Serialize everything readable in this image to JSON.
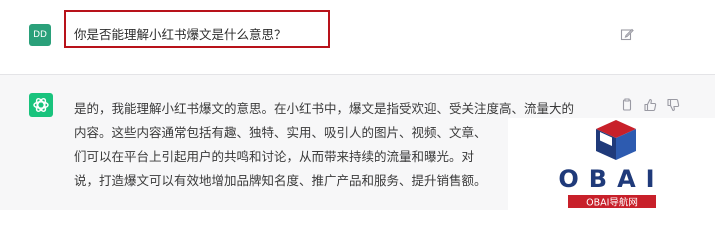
{
  "user": {
    "avatar_initials": "DD",
    "message": "你是否能理解小红书爆文是什么意思？"
  },
  "assistant": {
    "lines": [
      "是的，我能理解小红书爆文的意思。在小红书中，爆文是指受欢迎、受关注度高、流量大的",
      "内容。这些内容通常包括有趣、独特、实用、吸引人的图片、视频、文章、",
      "们可以在平台上引起用户的共鸣和讨论，从而带来持续的流量和曝光。对",
      "说，打造爆文可以有效地增加品牌知名度、推广产品和服务、提升销售额。"
    ]
  },
  "watermark": {
    "logo_text": "OBAI",
    "sub_text": "OBAI导航网"
  },
  "colors": {
    "highlight_border": "#b8121a",
    "user_avatar_bg": "#2aa07a",
    "assistant_avatar_bg": "#19c37d",
    "assistant_row_bg": "#f7f7f8",
    "watermark_blue": "#1f3a7a",
    "watermark_red": "#c8202a"
  },
  "icons": {
    "edit": "edit-icon",
    "copy": "copy-icon",
    "thumbs_up": "thumbs-up-icon",
    "thumbs_down": "thumbs-down-icon",
    "assistant_logo": "openai-logo-icon"
  }
}
